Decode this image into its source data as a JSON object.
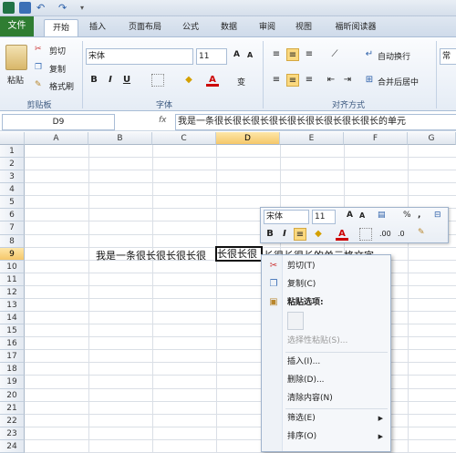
{
  "tabs": [
    {
      "label": "文件"
    },
    {
      "label": "开始"
    },
    {
      "label": "插入"
    },
    {
      "label": "页面布局"
    },
    {
      "label": "公式"
    },
    {
      "label": "数据"
    },
    {
      "label": "审阅"
    },
    {
      "label": "视图"
    },
    {
      "label": "福昕阅读器"
    }
  ],
  "clipboard": {
    "paste": "粘贴",
    "cut": "剪切",
    "copy": "复制",
    "format_painter": "格式刷",
    "group": "剪贴板"
  },
  "font": {
    "name": "宋体",
    "size": "11",
    "group": "字体",
    "grow": "A",
    "shrink": "A",
    "bold": "B",
    "italic": "I",
    "underline": "U",
    "font_color_glyph": "A",
    "phonetic": "变"
  },
  "align": {
    "group": "对齐方式",
    "wrap": "自动换行",
    "merge": "合并后居中"
  },
  "number": {
    "partial": "常"
  },
  "formula_bar": {
    "cell_ref": "D9",
    "fx": "fx",
    "content": "我是一条很长很长很长很长很长很长很长很长很长的单元"
  },
  "columns": [
    "A",
    "B",
    "C",
    "D",
    "E",
    "F",
    "G"
  ],
  "rows": [
    "1",
    "2",
    "3",
    "4",
    "5",
    "6",
    "7",
    "8",
    "9",
    "10",
    "11",
    "12",
    "13",
    "14",
    "15",
    "16",
    "17",
    "18",
    "19",
    "20",
    "21",
    "22",
    "23",
    "24"
  ],
  "cell_text_left": "我是一条很长很长很长很",
  "cell_text_edit": "长很长很",
  "cell_text_right": "长很长很长的单元格文字",
  "mini_toolbar": {
    "font": "宋体",
    "size": "11",
    "percent": "%",
    "comma": ","
  },
  "context_menu": [
    {
      "label": "剪切(T)"
    },
    {
      "label": "复制(C)"
    },
    {
      "label": "粘贴选项:"
    },
    {
      "label": "选择性粘贴(S)..."
    },
    {
      "label": "插入(I)..."
    },
    {
      "label": "删除(D)..."
    },
    {
      "label": "清除内容(N)"
    },
    {
      "label": "筛选(E)"
    },
    {
      "label": "排序(O)"
    }
  ]
}
